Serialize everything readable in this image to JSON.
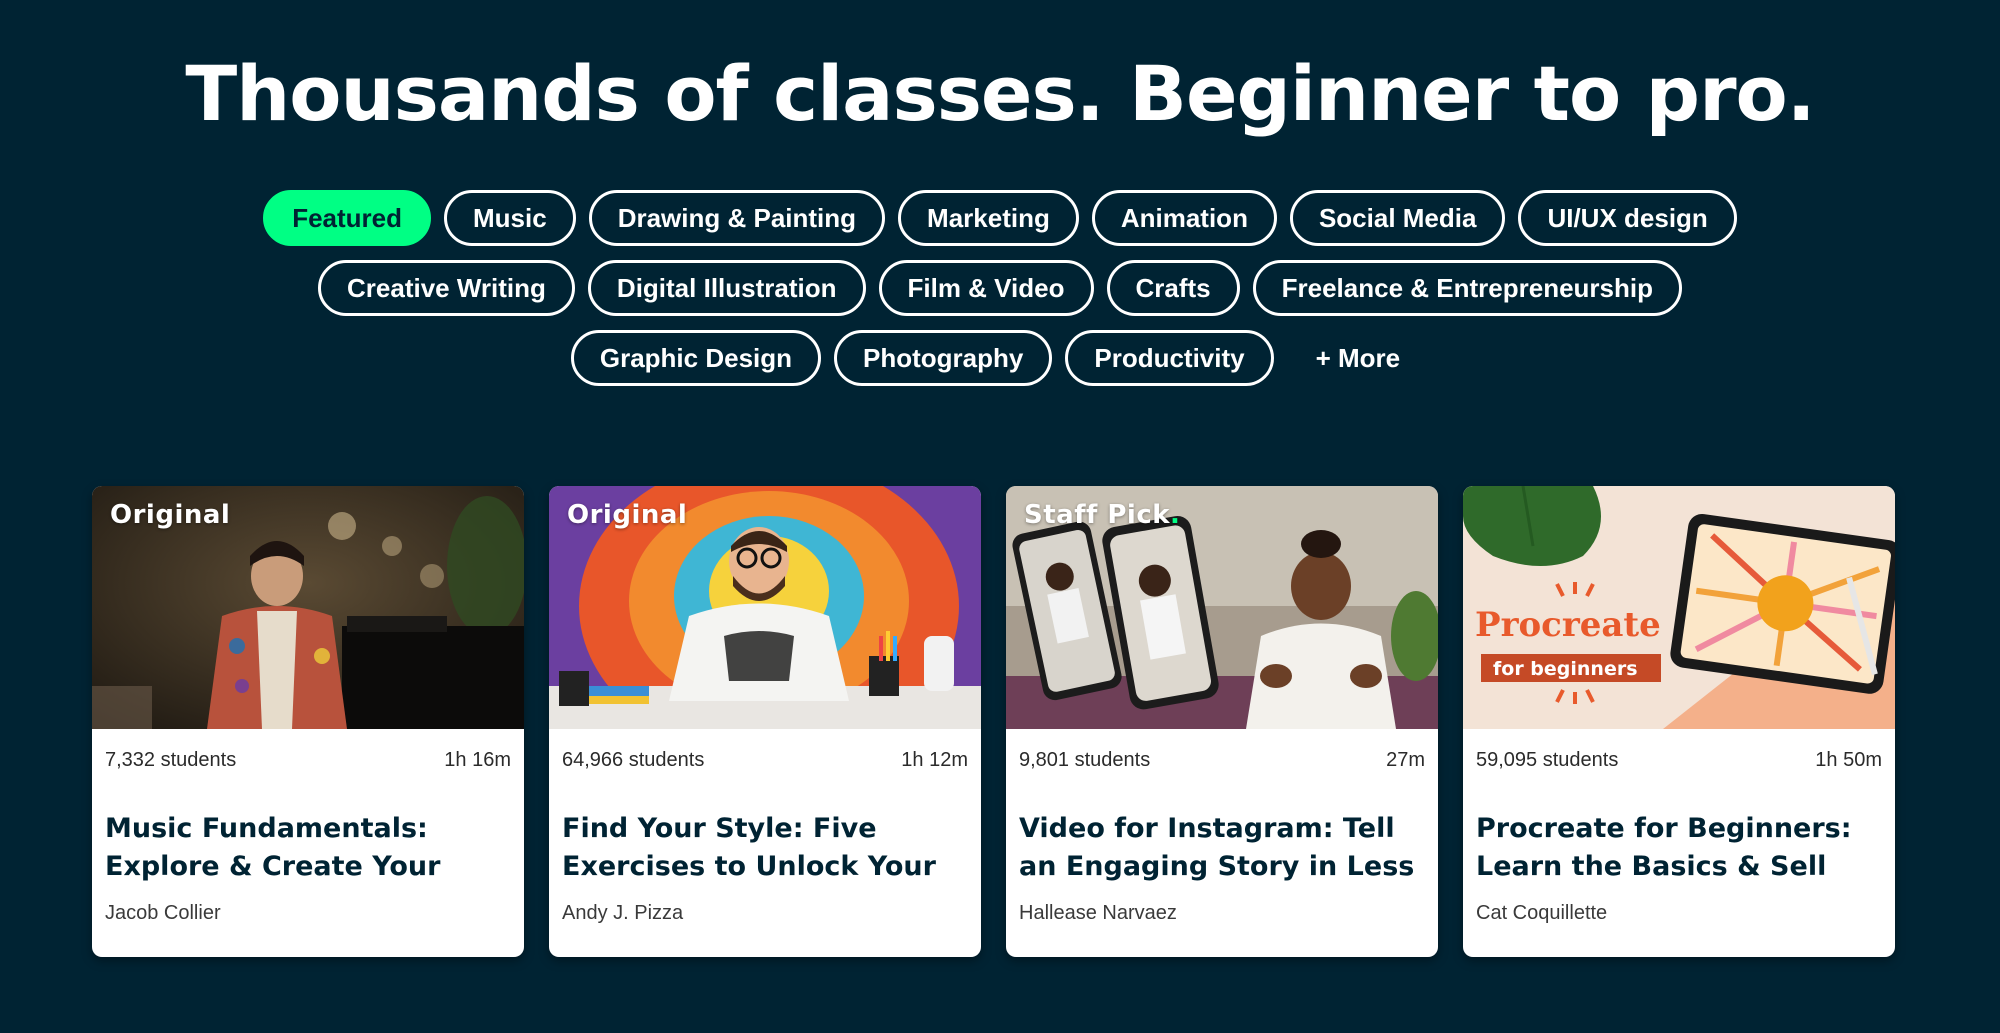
{
  "headline": "Thousands of classes. Beginner to pro.",
  "categories": {
    "row1": [
      "Featured",
      "Music",
      "Drawing & Painting",
      "Marketing",
      "Animation",
      "Social Media",
      "UI/UX design"
    ],
    "row2": [
      "Creative Writing",
      "Digital Illustration",
      "Film & Video",
      "Crafts",
      "Freelance & Entrepreneurship"
    ],
    "row3": [
      "Graphic Design",
      "Photography",
      "Productivity"
    ],
    "more": "+ More",
    "active": "Featured"
  },
  "cards": [
    {
      "badge": "Original",
      "students": "7,332 students",
      "duration": "1h 16m",
      "title": "Music Fundamentals: Explore & Create Your",
      "teacher": "Jacob Collier"
    },
    {
      "badge": "Original",
      "students": "64,966 students",
      "duration": "1h 12m",
      "title": "Find Your Style: Five Exercises to Unlock Your",
      "teacher": "Andy J. Pizza"
    },
    {
      "badge": "Staff Pick",
      "badge_dot": ".",
      "students": "9,801 students",
      "duration": "27m",
      "title": "Video for Instagram: Tell an Engaging Story in Less Than",
      "teacher": "Hallease Narvaez"
    },
    {
      "students": "59,095 students",
      "duration": "1h 50m",
      "title": "Procreate for Beginners: Learn the Basics & Sell Your",
      "teacher": "Cat Coquillette",
      "thumb_text": {
        "word": "Procreate",
        "sub": "for beginners"
      }
    }
  ],
  "colors": {
    "background": "#002333",
    "accent": "#00ff84",
    "card_title": "#002333"
  }
}
